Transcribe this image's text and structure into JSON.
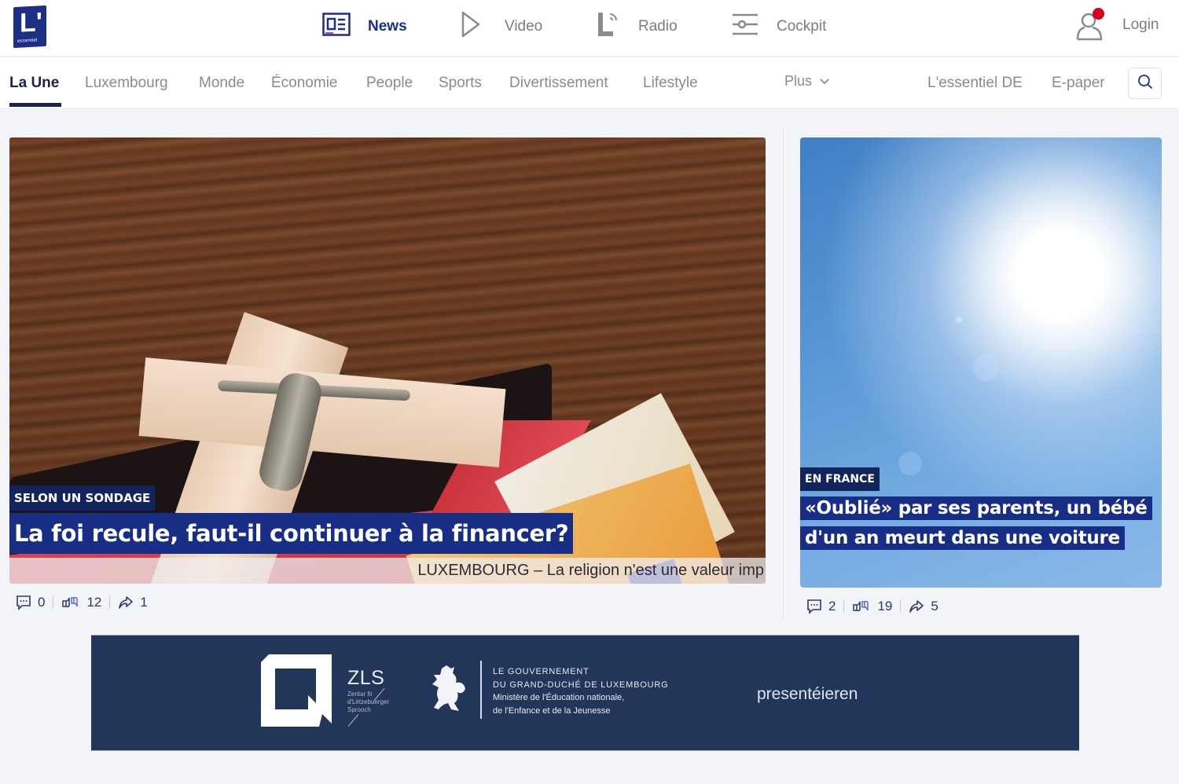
{
  "brand": {
    "logo_letter": "L'",
    "logo_small": "essentiel",
    "accent_color": "#1b2f86",
    "kicker_color": "#13245d",
    "notification_color": "#d6001c"
  },
  "top_nav": {
    "items": [
      {
        "label": "News",
        "icon": "newspaper-icon",
        "active": true
      },
      {
        "label": "Video",
        "icon": "play-icon",
        "active": false
      },
      {
        "label": "Radio",
        "icon": "radio-signal-icon",
        "active": false
      },
      {
        "label": "Cockpit",
        "icon": "sliders-icon",
        "active": false
      }
    ],
    "login_label": "Login"
  },
  "section_nav": {
    "items": [
      {
        "label": "La Une",
        "active": true
      },
      {
        "label": "Luxembourg"
      },
      {
        "label": "Monde"
      },
      {
        "label": "Économie"
      },
      {
        "label": "People"
      },
      {
        "label": "Sports"
      },
      {
        "label": "Divertissement"
      },
      {
        "label": "Lifestyle"
      }
    ],
    "more_label": "Plus",
    "right_links": [
      "L'essentiel DE",
      "E-paper"
    ]
  },
  "articles": {
    "main": {
      "kicker": "SELON UN SONDAGE",
      "headline": "La foi recule, faut-il continuer à la financer?",
      "lead": "LUXEMBOURG – La religion n'est une valeur imp",
      "comments": "0",
      "reactions": "12",
      "shares": "1"
    },
    "side": {
      "kicker": "EN FRANCE",
      "headline": "«Oublié» par ses parents, un bébé d'un an meurt dans une voiture",
      "comments": "2",
      "reactions": "19",
      "shares": "5"
    }
  },
  "banner": {
    "zls_title": "ZLS",
    "zls_subtitle": "Zentar fir d'Lëtzebuerger Sprooch",
    "gov_line1": "LE GOUVERNEMENT",
    "gov_line2": "DU GRAND-DUCHÉ DE LUXEMBOURG",
    "gov_line3": "Ministère de l'Éducation nationale,",
    "gov_line4": "de l'Enfance et de la Jeunesse",
    "presents": "presentéieren"
  }
}
